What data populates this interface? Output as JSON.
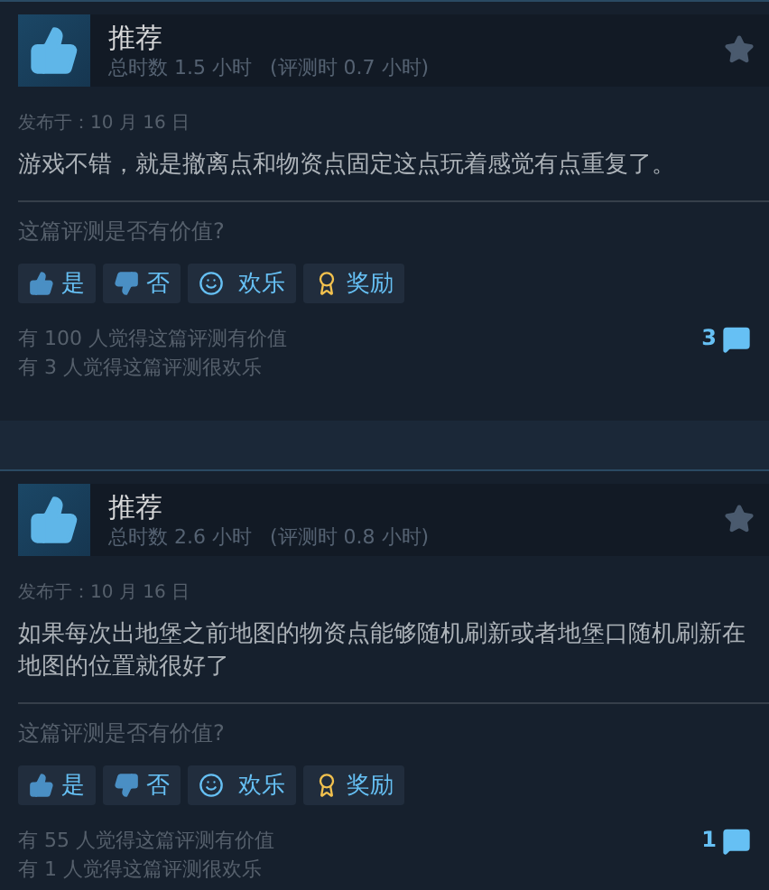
{
  "reviews": [
    {
      "verdict": "推荐",
      "recommended": true,
      "total_hours": "总时数 1.5 小时",
      "review_hours": "(评测时 0.7 小时)",
      "posted": "发布于：10 月 16 日",
      "text": "游戏不错，就是撤离点和物资点固定这点玩着感觉有点重复了。",
      "question": "这篇评测是否有价值?",
      "buttons": [
        {
          "kind": "yes",
          "label": "是"
        },
        {
          "kind": "no",
          "label": "否"
        },
        {
          "kind": "funny",
          "label": "欢乐"
        },
        {
          "kind": "award",
          "label": "奖励"
        }
      ],
      "helpful": "有 100 人觉得这篇评测有价值",
      "funny": "有 3 人觉得这篇评测很欢乐",
      "comments": "3"
    },
    {
      "verdict": "推荐",
      "recommended": true,
      "total_hours": "总时数 2.6 小时",
      "review_hours": "(评测时 0.8 小时)",
      "posted": "发布于：10 月 16 日",
      "text": "如果每次出地堡之前地图的物资点能够随机刷新或者地堡口随机刷新在地图的位置就很好了",
      "question": "这篇评测是否有价值?",
      "buttons": [
        {
          "kind": "yes",
          "label": "是"
        },
        {
          "kind": "no",
          "label": "否"
        },
        {
          "kind": "funny",
          "label": "欢乐"
        },
        {
          "kind": "award",
          "label": "奖励"
        }
      ],
      "helpful": "有 55 人觉得这篇评测有价值",
      "funny": "有 1 人觉得这篇评测很欢乐",
      "comments": "1"
    }
  ]
}
